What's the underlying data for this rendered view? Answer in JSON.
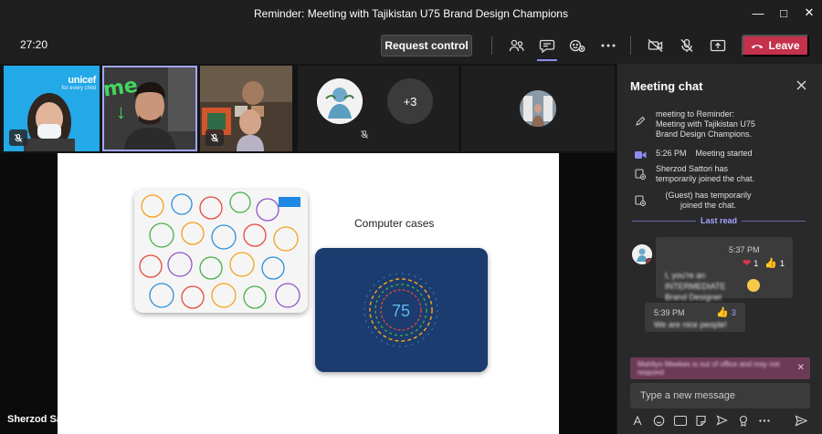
{
  "window": {
    "title": "Reminder: Meeting with Tajikistan U75 Brand Design Champions",
    "controls": [
      "minimize",
      "maximize",
      "close"
    ]
  },
  "toolbar": {
    "timer": "27:20",
    "request_control": "Request control",
    "leave": "Leave",
    "icons": [
      "people-icon",
      "chat-icon",
      "reactions-icon",
      "more-icon",
      "camera-off-icon",
      "mic-off-icon",
      "share-icon",
      "phone-icon"
    ],
    "colors": {
      "leave": "#c4314b",
      "active_tab": "#8b8cf0"
    }
  },
  "gallery": {
    "tiles": [
      {
        "name": "participant-unicef",
        "muted": true,
        "overlay_text": "unicef",
        "overlay_sub": "for every child"
      },
      {
        "name": "participant-me",
        "muted": false,
        "annotation": "me"
      },
      {
        "name": "participant-room",
        "muted": true
      },
      {
        "name": "participant-avatar",
        "muted": true,
        "overflow_count": "+3"
      },
      {
        "name": "participant-small-avatar"
      }
    ]
  },
  "stage": {
    "presenter": "Sherzod Sattori",
    "slide": {
      "caption": "Computer cases",
      "logo_number": "75"
    }
  },
  "chat": {
    "title": "Meeting chat",
    "system_messages": [
      {
        "icon": "pencil-icon",
        "time": "",
        "text": "meeting to Reminder: Meeting with Tajikistan U75 Brand Design Champions."
      },
      {
        "icon": "video-icon",
        "time": "5:26 PM",
        "text": "Meeting started"
      },
      {
        "icon": "join-icon",
        "time": "",
        "text": "Sherzod Sattori has temporarily joined the chat."
      },
      {
        "icon": "join-icon",
        "time": "",
        "text": "(Guest) has temporarily joined the chat."
      }
    ],
    "last_read": "Last read",
    "messages": [
      {
        "time": "5:37 PM",
        "text": "I, you're an INTERMEDIATE Brand Designer",
        "reactions": [
          {
            "icon": "heart-icon",
            "count": "1"
          },
          {
            "icon": "thumbs-up-icon",
            "count": "1"
          }
        ]
      },
      {
        "time": "5:39 PM",
        "text": "We are nice people!",
        "reactions": [
          {
            "icon": "thumbs-up-icon",
            "count": "3"
          }
        ]
      }
    ],
    "banner": "Mahliyo Meekes is out of office and may not respond",
    "compose_placeholder": "Type a new message",
    "format_icons": [
      "format-icon",
      "attach-icon",
      "emoji-icon",
      "gif-icon",
      "sticker-icon",
      "meet-now-icon",
      "praise-icon",
      "more-apps-icon"
    ]
  }
}
